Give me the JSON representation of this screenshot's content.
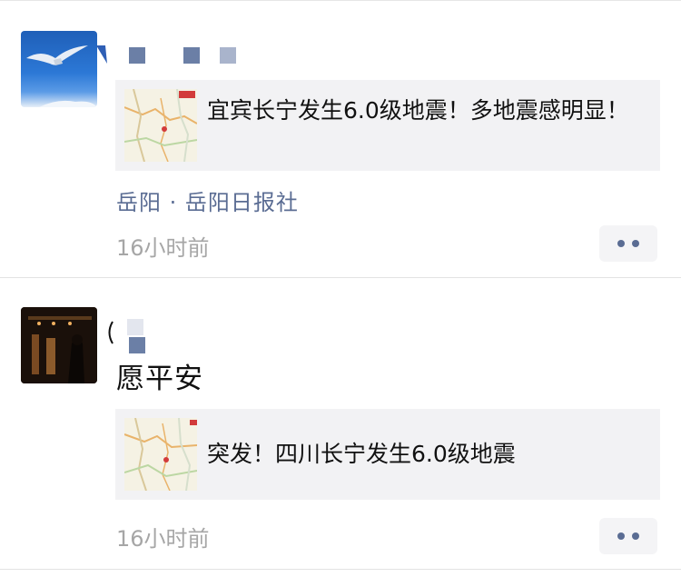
{
  "feed": {
    "posts": [
      {
        "author_name": "",
        "text": "",
        "share": {
          "title": "宜宾长宁发生6.0级地震！多地震感明显！"
        },
        "location": "岳阳 · 岳阳日报社",
        "time": "16小时前"
      },
      {
        "author_name": "",
        "text": "愿平安",
        "share": {
          "title": "突发！四川长宁发生6.0级地震"
        },
        "location": "",
        "time": "16小时前"
      }
    ]
  },
  "colors": {
    "link": "#5a6c93",
    "timestamp": "#a6a6a6",
    "card_bg": "#f2f2f4"
  }
}
